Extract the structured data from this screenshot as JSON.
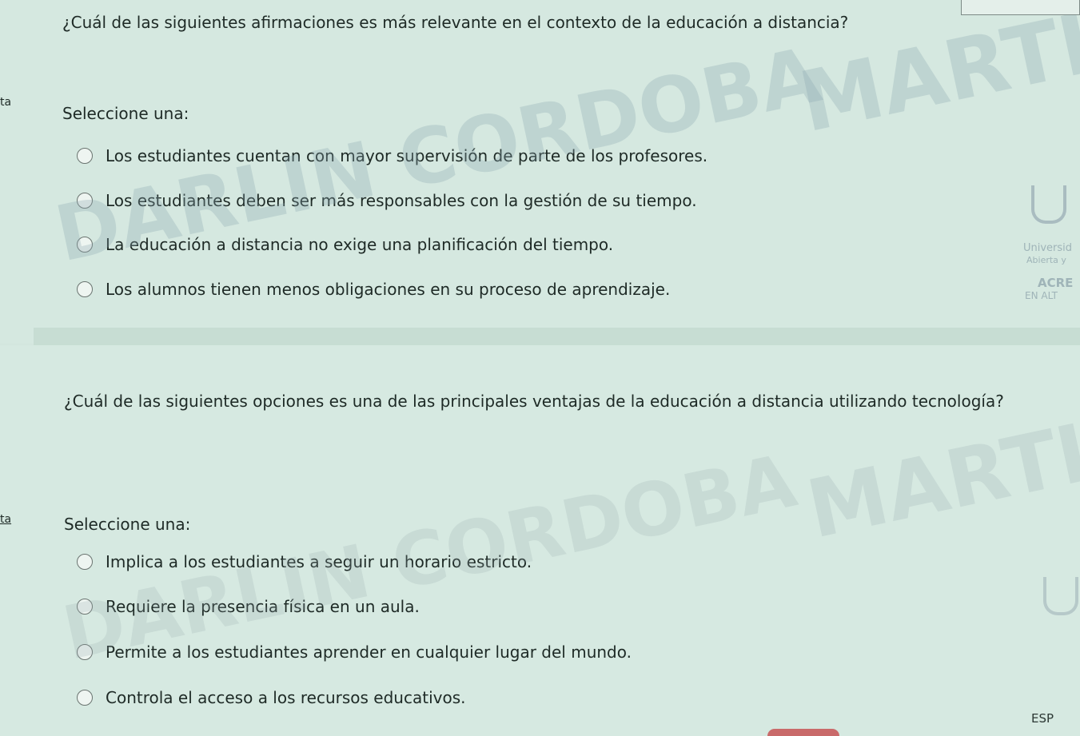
{
  "question1": {
    "text": "¿Cuál de las siguientes afirmaciones es más relevante en el contexto de la educación a distancia?",
    "side_label": "ta",
    "prompt": "Seleccione una:",
    "options": [
      "Los estudiantes cuentan con mayor supervisión de parte de los profesores.",
      "Los estudiantes deben ser más responsables con la gestión de su tiempo.",
      "La educación a distancia no exige una planificación del tiempo.",
      "Los alumnos tienen menos obligaciones en su proceso de aprendizaje."
    ]
  },
  "question2": {
    "text": "¿Cuál de las siguientes opciones es una de las principales ventajas de la educación a distancia utilizando tecnología?",
    "side_label": "ta",
    "prompt": "Seleccione una:",
    "options": [
      "Implica a los estudiantes a seguir un horario estricto.",
      "Requiere la presencia física en un aula.",
      "Permite a los estudiantes aprender en cualquier lugar del mundo.",
      "Controla el acceso a los recursos educativos."
    ]
  },
  "watermark": {
    "line_top": "MARTIN",
    "line_bottom": "DARLIN CORDOBA"
  },
  "university_logo": {
    "line1": "Universid",
    "line2": "Abierta y",
    "line3": "ACRE",
    "line4": "EN ALT"
  },
  "taskbar": {
    "language": "ESP"
  }
}
